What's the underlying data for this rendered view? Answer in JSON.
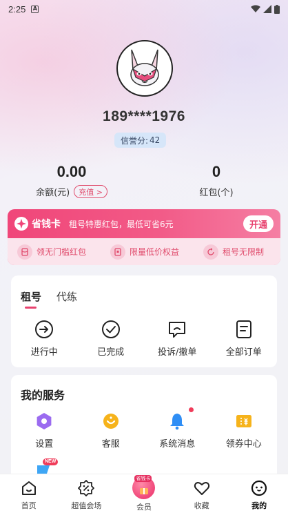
{
  "status_bar": {
    "time": "2:25"
  },
  "profile": {
    "phone": "189****1976",
    "credit_label": "信誉分:",
    "credit_score": "42"
  },
  "wallet": {
    "balance_value": "0.00",
    "balance_label": "余额(元)",
    "recharge_label": "充值 >",
    "redpacket_value": "0",
    "redpacket_label": "红包(个)"
  },
  "vip_card": {
    "title": "省钱卡",
    "description": "租号特惠红包，最低可省6元",
    "open_label": "开通",
    "perks": [
      "领无门槛红包",
      "限量低价权益",
      "租号无限制"
    ]
  },
  "orders": {
    "tabs": [
      "租号",
      "代练"
    ],
    "items": [
      {
        "label": "进行中",
        "icon": "arrow-circle-icon"
      },
      {
        "label": "已完成",
        "icon": "check-circle-icon"
      },
      {
        "label": "投诉/撤单",
        "icon": "complaint-icon"
      },
      {
        "label": "全部订单",
        "icon": "order-list-icon"
      }
    ]
  },
  "services": {
    "title": "我的服务",
    "items": [
      {
        "label": "设置",
        "icon": "settings-icon",
        "color": "#9b6bf0"
      },
      {
        "label": "客服",
        "icon": "customer-service-icon",
        "color": "#f6b31b"
      },
      {
        "label": "系统消息",
        "icon": "bell-icon",
        "color": "#2f8ef5",
        "has_dot": true
      },
      {
        "label": "领券中心",
        "icon": "coupon-icon",
        "color": "#f6b31b"
      }
    ],
    "new_badge": "NEW"
  },
  "bottom_nav": {
    "items": [
      "首页",
      "超值会场",
      "会员",
      "收藏",
      "我的"
    ],
    "vip_tag": "省钱卡"
  },
  "colors": {
    "accent": "#e8426f",
    "card_gradient_start": "#f04679",
    "card_gradient_end": "#f57ea3"
  }
}
